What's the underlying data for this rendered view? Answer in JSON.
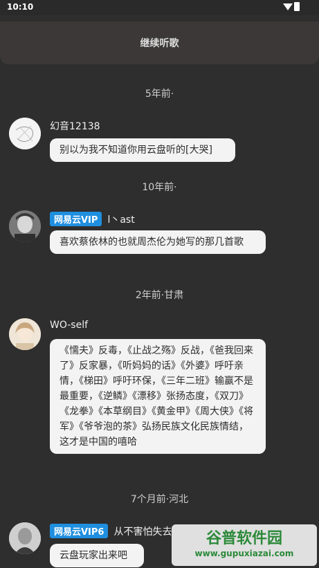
{
  "status_bar": {
    "time": "10:10"
  },
  "banner": {
    "label": "继续听歌"
  },
  "comments": [
    {
      "timestamp": "5年前·",
      "nickname": "幻音12138",
      "vip": "",
      "text": "别以为我不知道你用云盘听的[大哭]"
    },
    {
      "timestamp": "10年前·",
      "nickname": "l丶ast",
      "vip": "网易云VIP",
      "text": "喜欢蔡依林的也就周杰伦为她写的那几首歌"
    },
    {
      "timestamp": "2年前·甘肃",
      "nickname": "WO-self",
      "vip": "",
      "text": "《懦夫》反毒，《止战之殇》反战，《爸我回来了》反家暴，《听妈妈的话》《外婆》呼吁亲情，《梯田》呼吁环保，《三年二班》输赢不是最重要，《逆鳞》《漂移》张扬态度，《双刀》《龙拳》《本草纲目》《黄金甲》《周大侠》《将军》《爷爷泡的茶》弘扬民族文化民族情结，这才是中国的嘻哈"
    },
    {
      "timestamp": "7个月前·河北",
      "nickname": "从不害怕失去",
      "vip": "网易云VIP6",
      "text": "云盘玩家出来吧"
    }
  ],
  "watermark": {
    "title": "谷普软件园",
    "url": "www.gupuxiazai.com"
  }
}
